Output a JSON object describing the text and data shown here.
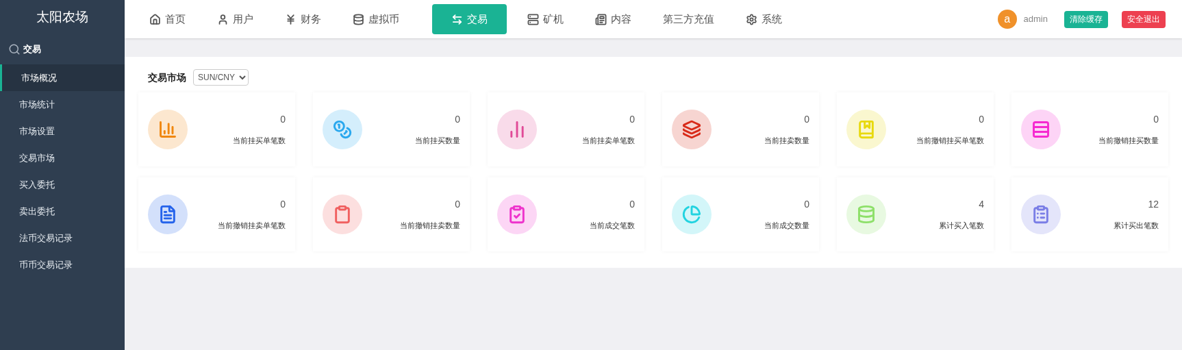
{
  "sidebar": {
    "title": "太阳农场",
    "section": "交易",
    "items": [
      {
        "label": "市场概况",
        "selected": true
      },
      {
        "label": "市场统计",
        "selected": false
      },
      {
        "label": "市场设置",
        "selected": false
      },
      {
        "label": "交易市场",
        "selected": false
      },
      {
        "label": "买入委托",
        "selected": false
      },
      {
        "label": "卖出委托",
        "selected": false
      },
      {
        "label": "法币交易记录",
        "selected": false
      },
      {
        "label": "币币交易记录",
        "selected": false
      }
    ]
  },
  "nav": {
    "items": [
      {
        "label": "首页",
        "kind": "home",
        "selected": false
      },
      {
        "label": "用户",
        "kind": "user",
        "selected": false
      },
      {
        "label": "财务",
        "kind": "finance",
        "selected": false
      },
      {
        "label": "虚拟币",
        "kind": "coins",
        "selected": false
      },
      {
        "label": "交易",
        "kind": "trade",
        "selected": true
      },
      {
        "label": "矿机",
        "kind": "server",
        "selected": false
      },
      {
        "label": "内容",
        "kind": "content",
        "selected": false
      },
      {
        "label": "第三方充值",
        "kind": "none",
        "selected": false
      },
      {
        "label": "系统",
        "kind": "settings",
        "selected": false
      }
    ],
    "avatar": "a",
    "user": "admin",
    "buttons": [
      {
        "label": "清除缓存",
        "kind": "primary"
      },
      {
        "label": "安全退出",
        "kind": "danger"
      }
    ]
  },
  "market": {
    "title": "交易市场",
    "pair": "SUN/CNY",
    "cards": [
      {
        "value": "0",
        "label": "当前挂买单笔数",
        "kind": "bar-chart",
        "color": "#f0870f"
      },
      {
        "value": "0",
        "label": "当前挂买数量",
        "kind": "coins",
        "color": "#2aa8ee"
      },
      {
        "value": "0",
        "label": "当前挂卖单笔数",
        "kind": "bar-chart-2",
        "color": "#e04a97"
      },
      {
        "value": "0",
        "label": "当前挂卖数量",
        "kind": "layers",
        "color": "#d82b1a"
      },
      {
        "value": "0",
        "label": "当前撤销挂买单笔数",
        "kind": "book",
        "color": "#e8d90d"
      },
      {
        "value": "0",
        "label": "当前撤销挂买数量",
        "kind": "rows",
        "color": "#f62ad0"
      },
      {
        "value": "0",
        "label": "当前撤销挂卖单笔数",
        "kind": "document",
        "color": "#2563eb"
      },
      {
        "value": "0",
        "label": "当前撤销挂卖数量",
        "kind": "clipboard",
        "color": "#f06060"
      },
      {
        "value": "0",
        "label": "当前成交笔数",
        "kind": "clipboard-check",
        "color": "#ee33cc"
      },
      {
        "value": "0",
        "label": "当前成交数量",
        "kind": "pie",
        "color": "#22d3e0"
      },
      {
        "value": "4",
        "label": "累计买入笔数",
        "kind": "database",
        "color": "#8ee06a"
      },
      {
        "value": "12",
        "label": "累计买出笔数",
        "kind": "clipboard-list",
        "color": "#7a7ee6"
      }
    ]
  }
}
